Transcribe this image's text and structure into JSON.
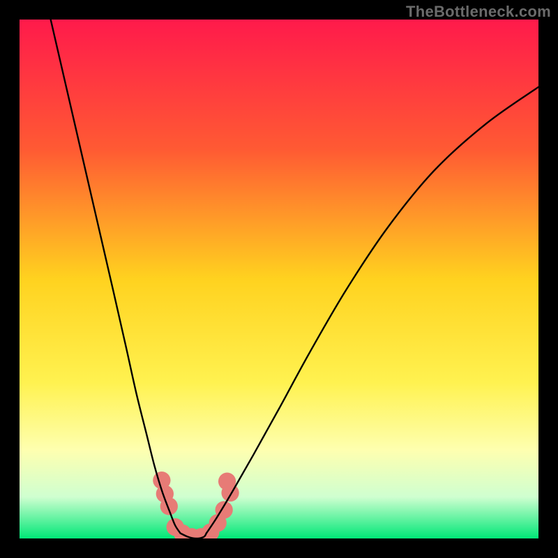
{
  "watermark": "TheBottleneck.com",
  "chart_data": {
    "type": "line",
    "title": "",
    "xlabel": "",
    "ylabel": "",
    "xlim": [
      0,
      1
    ],
    "ylim": [
      0,
      1
    ],
    "background_gradient": {
      "stops": [
        {
          "offset": 0.0,
          "color": "#ff1a4b"
        },
        {
          "offset": 0.25,
          "color": "#ff5a33"
        },
        {
          "offset": 0.5,
          "color": "#ffd21f"
        },
        {
          "offset": 0.7,
          "color": "#fff250"
        },
        {
          "offset": 0.83,
          "color": "#feffb0"
        },
        {
          "offset": 0.92,
          "color": "#cfffd0"
        },
        {
          "offset": 1.0,
          "color": "#00e777"
        }
      ]
    },
    "series": [
      {
        "name": "left-branch",
        "type": "curve",
        "x": [
          0.06,
          0.09,
          0.12,
          0.15,
          0.18,
          0.205,
          0.225,
          0.245,
          0.26,
          0.275,
          0.29,
          0.3,
          0.31
        ],
        "y": [
          1.0,
          0.87,
          0.74,
          0.61,
          0.48,
          0.37,
          0.28,
          0.2,
          0.14,
          0.09,
          0.05,
          0.025,
          0.01
        ]
      },
      {
        "name": "right-branch",
        "type": "curve",
        "x": [
          0.36,
          0.38,
          0.41,
          0.45,
          0.5,
          0.56,
          0.63,
          0.71,
          0.8,
          0.9,
          1.0
        ],
        "y": [
          0.01,
          0.04,
          0.09,
          0.16,
          0.25,
          0.36,
          0.48,
          0.6,
          0.71,
          0.8,
          0.87
        ]
      },
      {
        "name": "valley-floor",
        "type": "curve",
        "x": [
          0.31,
          0.325,
          0.34,
          0.355,
          0.36
        ],
        "y": [
          0.01,
          0.003,
          0.0,
          0.003,
          0.01
        ]
      }
    ],
    "markers": {
      "name": "highlight-dots",
      "color": "#e77b76",
      "radius_rel": 0.017,
      "points": [
        {
          "x": 0.274,
          "y": 0.112
        },
        {
          "x": 0.28,
          "y": 0.086
        },
        {
          "x": 0.288,
          "y": 0.062
        },
        {
          "x": 0.3,
          "y": 0.022
        },
        {
          "x": 0.314,
          "y": 0.01
        },
        {
          "x": 0.332,
          "y": 0.003
        },
        {
          "x": 0.35,
          "y": 0.003
        },
        {
          "x": 0.368,
          "y": 0.012
        },
        {
          "x": 0.382,
          "y": 0.03
        },
        {
          "x": 0.394,
          "y": 0.055
        },
        {
          "x": 0.406,
          "y": 0.088
        },
        {
          "x": 0.4,
          "y": 0.11
        }
      ]
    }
  }
}
